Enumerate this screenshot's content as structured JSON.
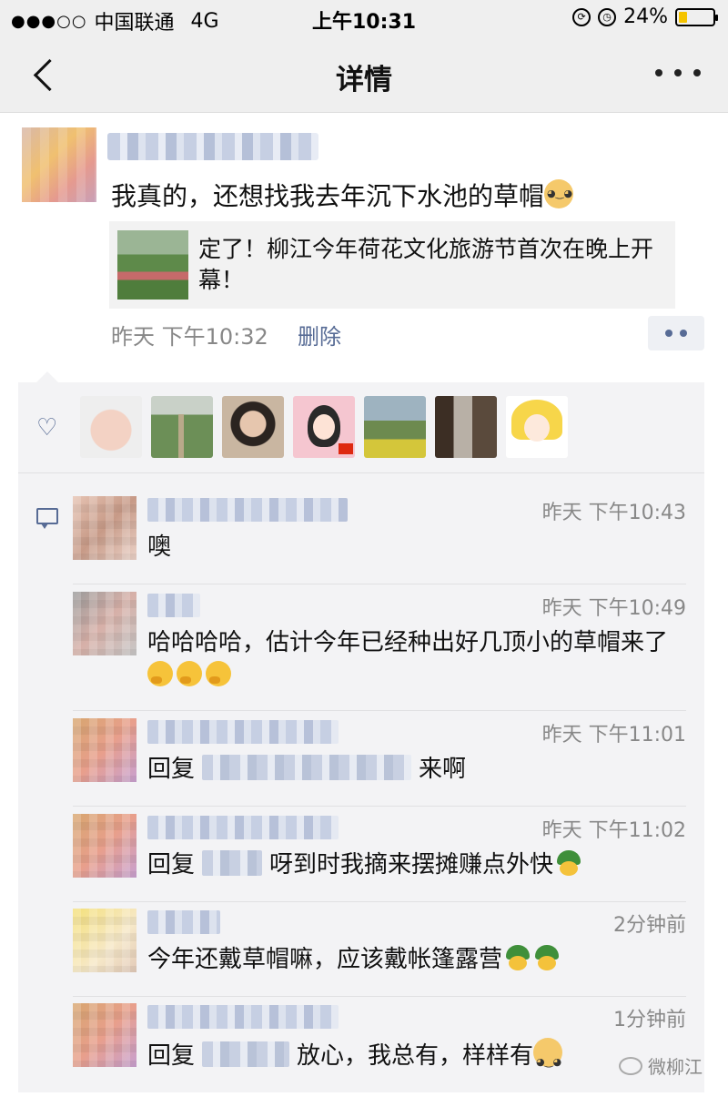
{
  "status_bar": {
    "signal": "●●●○○",
    "carrier": "中国联通",
    "network": "4G",
    "time": "上午10:31",
    "battery": "24%",
    "battery_fill": 0.24
  },
  "nav": {
    "title": "详情"
  },
  "post": {
    "text": "我真的，还想找我去年沉下水池的草帽",
    "link_title": "定了！柳江今年荷花文化旅游节首次在晚上开幕！",
    "time": "昨天  下午10:32",
    "delete_label": "删除"
  },
  "comments": [
    {
      "time": "昨天  下午10:43",
      "text": "噢"
    },
    {
      "time": "昨天  下午10:49",
      "text": "哈哈哈哈，估计今年已经种出好几顶小的草帽来了"
    },
    {
      "time": "昨天  下午11:01",
      "prefix": "回复",
      "text": "来啊"
    },
    {
      "time": "昨天  下午11:02",
      "prefix": "回复",
      "text": "呀到时我摘来摆摊赚点外快"
    },
    {
      "time": "2分钟前",
      "text": "今年还戴草帽嘛，应该戴帐篷露营"
    },
    {
      "time": "1分钟前",
      "prefix": "回复",
      "text": "放心，我总有，样样有"
    }
  ],
  "watermark": "微柳江",
  "colors": {
    "link": "#576b95",
    "meta": "#888888",
    "panel": "#f3f3f5"
  }
}
